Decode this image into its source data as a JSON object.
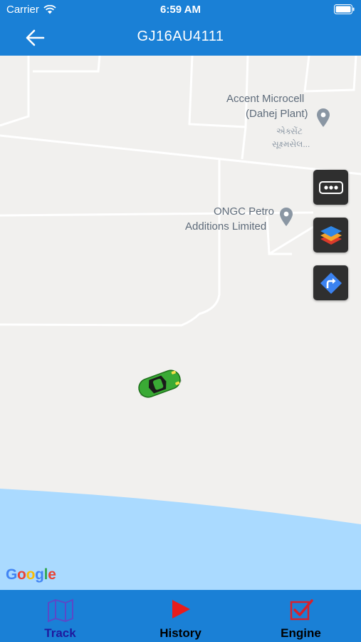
{
  "status_bar": {
    "carrier": "Carrier",
    "time": "6:59 AM"
  },
  "header": {
    "title": "GJ16AU4111"
  },
  "map": {
    "places": [
      {
        "name_line1": "Accent Microcell",
        "name_line2": "(Dahej Plant)",
        "local_line1": "એક્સેંટ",
        "local_line2": "સૂક્ષ્મસેલ..."
      },
      {
        "name_line1": "ONGC Petro",
        "name_line2": "Additions Limited"
      }
    ],
    "attribution": "Google",
    "controls": [
      "more-options",
      "map-layers",
      "directions"
    ]
  },
  "tabs": [
    {
      "label": "Track",
      "icon": "map-icon",
      "color": "#1f1a9e"
    },
    {
      "label": "History",
      "icon": "play-icon",
      "color": "#000000"
    },
    {
      "label": "Engine",
      "icon": "checkbox-icon",
      "color": "#000000"
    }
  ],
  "colors": {
    "accent": "#1a80d6",
    "water": "#aadaff",
    "land": "#f1f0ee",
    "vehicle": "#3aaa35"
  }
}
